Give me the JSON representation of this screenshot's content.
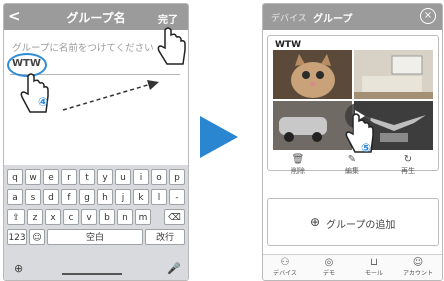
{
  "left": {
    "header": {
      "back": "<",
      "title": "グループ名",
      "done": "完了"
    },
    "input": {
      "placeholder": "グループに名前をつけてください",
      "value": "WTW"
    },
    "step_number": "④",
    "keyboard": {
      "row1": [
        "q",
        "w",
        "e",
        "r",
        "t",
        "y",
        "u",
        "i",
        "o",
        "p"
      ],
      "row2": [
        "a",
        "s",
        "d",
        "f",
        "g",
        "h",
        "j",
        "k",
        "l",
        "-"
      ],
      "row3": [
        "⇧",
        "z",
        "x",
        "c",
        "v",
        "b",
        "n",
        "m",
        "⌫"
      ],
      "row4": {
        "num": "123",
        "emoji": "☺",
        "space": "空白",
        "enter": "改行"
      },
      "globe": "⊕",
      "mic": "🎤"
    }
  },
  "right": {
    "header": {
      "crumb": "デバイス",
      "title": "グループ",
      "close": "×"
    },
    "group": {
      "name": "WTW",
      "actions": [
        {
          "icon": "🗑",
          "label": "削除"
        },
        {
          "icon": "✎",
          "label": "編集"
        },
        {
          "icon": "↻",
          "label": "再生"
        }
      ]
    },
    "step_number": "⑤",
    "add_group": {
      "icon": "⊕",
      "label": "グループの追加"
    },
    "tabs": [
      {
        "icon": "⚇",
        "label": "デバイス"
      },
      {
        "icon": "◎",
        "label": "デモ"
      },
      {
        "icon": "⊔",
        "label": "モール"
      },
      {
        "icon": "☺",
        "label": "アカウント"
      }
    ]
  },
  "colors": {
    "accent": "#2e8bd8",
    "header": "#9b9b9b",
    "arrow": "#2a86d0"
  }
}
